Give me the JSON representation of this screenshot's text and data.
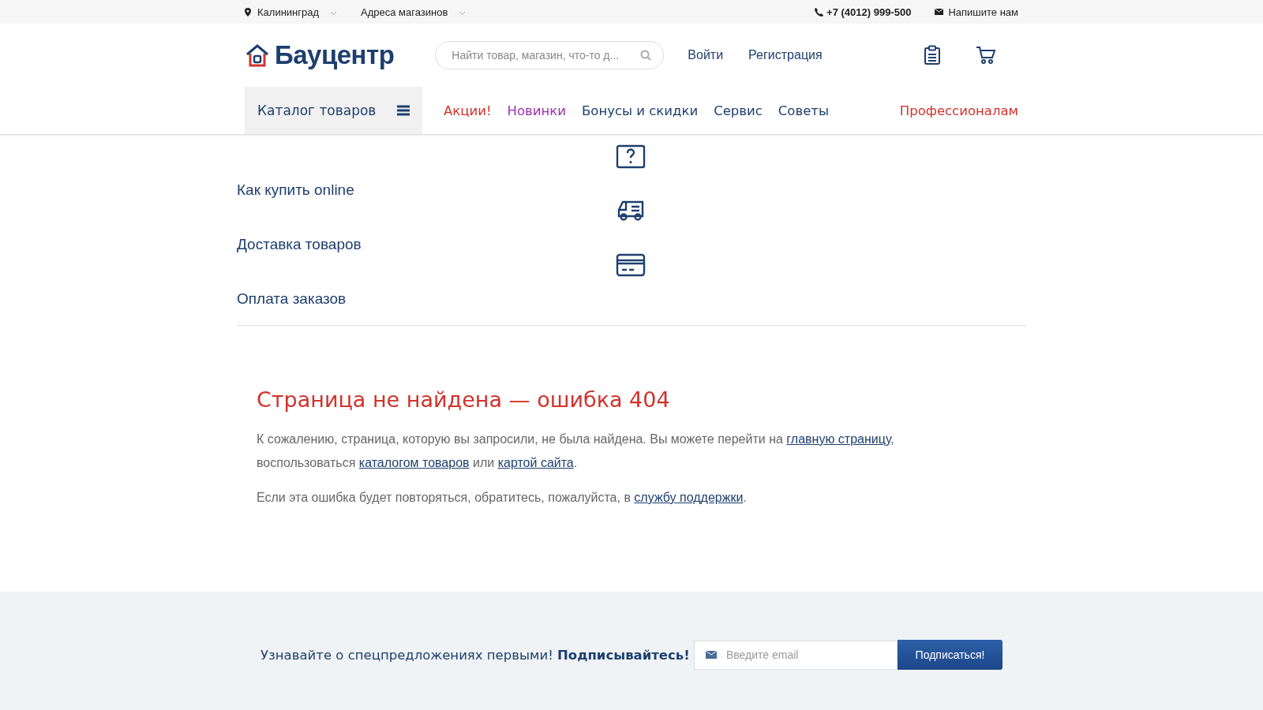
{
  "top_bar": {
    "city": "Калининград",
    "stores": "Адреса магазинов",
    "phone": "+7 (4012) 999-500",
    "write_us": "Напишите нам"
  },
  "header": {
    "logo": "Бауцентр",
    "search": {
      "placeholder": "Найти товар, магазин, что-то д..."
    },
    "login": "Войти",
    "register": "Регистрация"
  },
  "nav": {
    "catalog": "Каталог товаров",
    "items": [
      {
        "label": "Акции!",
        "color": "#d0332c"
      },
      {
        "label": "Новинки",
        "color": "#9b2fae"
      },
      {
        "label": "Бонусы и скидки",
        "color": "#1d3f6e"
      },
      {
        "label": "Сервис",
        "color": "#1d3f6e"
      },
      {
        "label": "Советы",
        "color": "#1d3f6e"
      }
    ],
    "pro": {
      "label": "Профессионалам",
      "color": "#d0332c"
    }
  },
  "help_menu": [
    {
      "kind": "question",
      "label": "Как купить online"
    },
    {
      "kind": "truck",
      "label": "Доставка товаров"
    },
    {
      "kind": "card",
      "label": "Оплата заказов"
    }
  ],
  "error": {
    "title": "Страница не найдена — ошибка 404",
    "paragraphs": [
      [
        {
          "kind": "text",
          "text": "К сожалению, страница, которую вы запросили, не была найдена. Вы можете перейти на "
        },
        {
          "kind": "link",
          "text": "главную страницу"
        },
        {
          "kind": "text",
          "text": ", воспользоваться "
        },
        {
          "kind": "link",
          "text": "каталогом товаров"
        },
        {
          "kind": "text",
          "text": " или "
        },
        {
          "kind": "link",
          "text": "картой сайта"
        },
        {
          "kind": "text",
          "text": "."
        }
      ],
      [
        {
          "kind": "text",
          "text": "Если эта ошибка будет повторяться, обратитесь, пожалуйста, в "
        },
        {
          "kind": "link",
          "text": "службу поддержки"
        },
        {
          "kind": "text",
          "text": "."
        }
      ]
    ]
  },
  "subscribe": {
    "text": "Узнавайте о спецпредложениях первыми! **Подписывайтесь!**",
    "placeholder": "Введите email",
    "button": "Подписаться!"
  }
}
